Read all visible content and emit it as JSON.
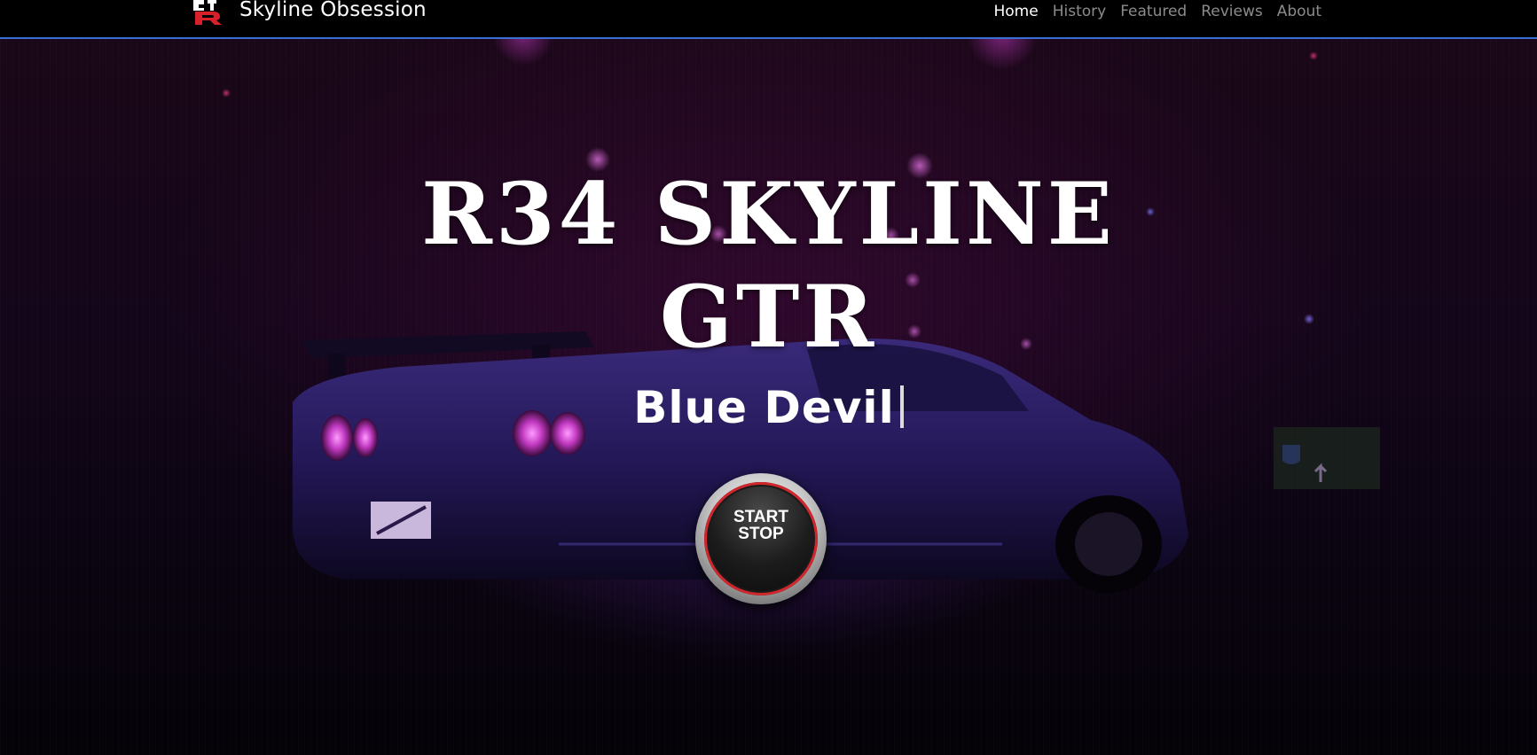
{
  "navbar": {
    "brand_name": "Skyline Obsession",
    "logo_icon": "gtr-logo-icon",
    "links": [
      {
        "label": "Home",
        "active": true
      },
      {
        "label": "History",
        "active": false
      },
      {
        "label": "Featured",
        "active": false
      },
      {
        "label": "Reviews",
        "active": false
      },
      {
        "label": "About",
        "active": false
      }
    ],
    "accent_color": "#3b6fd6"
  },
  "hero": {
    "title_line1": "R34 SKYLINE",
    "title_line2": "GTR",
    "subtitle": "Blue Devil",
    "button": {
      "line1": "START",
      "line2": "STOP",
      "ring_color": "#d0262c"
    }
  }
}
